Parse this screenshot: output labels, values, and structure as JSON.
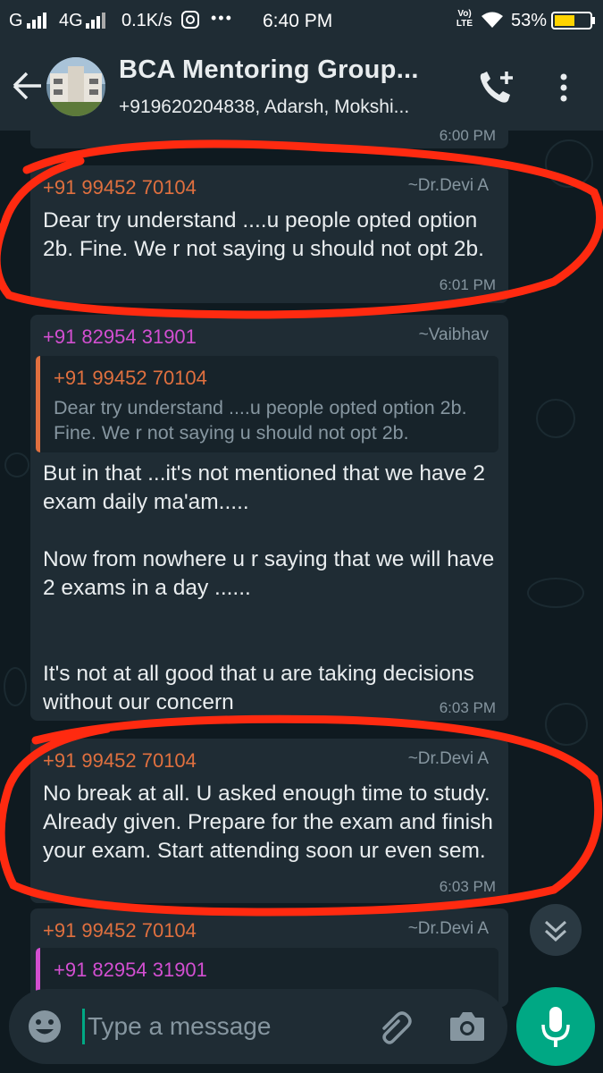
{
  "status": {
    "carrier": "G",
    "network": "4G",
    "speed": "0.1K/s",
    "dots": "•••",
    "time": "6:40 PM",
    "volte": "Vo) LTE",
    "battery": "53%"
  },
  "header": {
    "title": "BCA Mentoring Group...",
    "subtitle": "+919620204838, Adarsh, Mokshi..."
  },
  "messages": [
    {
      "time_partial": "6:00 PM"
    },
    {
      "sender": "+91 99452 70104",
      "alias": "~Dr.Devi A",
      "text": "Dear try understand ....u people opted option 2b. Fine. We r not saying u should not opt 2b.",
      "time": "6:01 PM"
    },
    {
      "sender": "+91 82954 31901",
      "alias": "~Vaibhav",
      "quote": {
        "sender": "+91 99452 70104",
        "text": "Dear try understand ....u people opted option 2b. Fine. We r not saying u should not opt 2b."
      },
      "text": "But in that ...it's not mentioned that we have 2 exam daily ma'am.....\n\nNow from nowhere u r saying that we will have 2 exams in a day ......\n\n\nIt's not at all good that u are  taking decisions without our concern",
      "time": "6:03 PM"
    },
    {
      "sender": "+91 99452 70104",
      "alias": "~Dr.Devi A",
      "text": "No break at all. U asked enough time to study. Already given. Prepare for the exam and finish your exam. Start attending soon ur even sem.",
      "time": "6:03 PM"
    },
    {
      "sender": "+91 99452 70104",
      "alias": "~Dr.Devi A",
      "quote": {
        "sender": "+91 82954 31901"
      }
    }
  ],
  "composer": {
    "placeholder": "Type a message"
  },
  "icons": {
    "back": "back-arrow-icon",
    "add_call": "add-call-icon",
    "menu": "more-vert-icon",
    "emoji": "emoji-icon",
    "attach": "paperclip-icon",
    "camera": "camera-icon",
    "mic": "mic-icon",
    "scroll": "chevrons-down-icon"
  },
  "colors": {
    "sender_orange": "#e0703f",
    "sender_pink": "#d34fd1",
    "accent": "#00a884",
    "annotation_red": "#ff2a10"
  }
}
